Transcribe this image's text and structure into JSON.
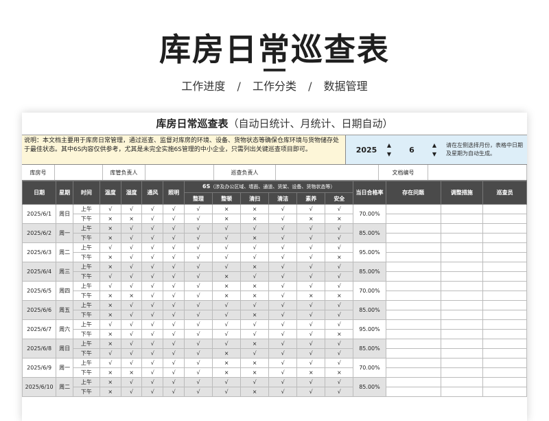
{
  "hero": {
    "title": "库房日常巡查表",
    "breadcrumb": [
      "工作进度",
      "工作分类",
      "数据管理"
    ],
    "sep": "/"
  },
  "sheet": {
    "title_main": "库房日常巡查表",
    "title_sub": "（自动日统计、月统计、日期自动）",
    "description": "说明：本文档主要用于库房日常管理，通过巡查、监督对库房的环境、设备、货物状态等确保仓库环境与货物储存处于最佳状态。其中6S内容仅供参考，尤其是未完全实施6S管理的中小企业，只需列出关键巡查项目即可。",
    "year": "2025",
    "month": "6",
    "spin_up": "▲",
    "spin_down": "▼",
    "hint": "请在左侧选择月份，表格中日期及星期为自动生成。",
    "meta": {
      "warehouse_no": "库房号",
      "warehouse_manager": "库管负责人",
      "inspector": "巡查负责人",
      "doc_no": "文档编号"
    },
    "headers": {
      "date": "日期",
      "weekday": "星期",
      "time": "时间",
      "temperature": "温度",
      "humidity": "湿度",
      "ventilation": "通风",
      "lighting": "照明",
      "six_s_title": "6S",
      "six_s_note": "（涉及办公区域、墙面、通道、货架、设备、货物状态等）",
      "six_s": [
        "整理",
        "整顿",
        "清扫",
        "清洁",
        "素养",
        "安全"
      ],
      "pass_rate": "当日合格率",
      "issues": "存在问题",
      "measures": "调整措施",
      "inspector_col": "巡查员"
    },
    "rows": [
      {
        "date": "2025/6/1",
        "weekday": "周日",
        "rate": "70.00%",
        "am": [
          "上午",
          "√",
          "√",
          "√",
          "√",
          "√",
          "×",
          "×",
          "√",
          "√",
          "√"
        ],
        "pm": [
          "下午",
          "×",
          "×",
          "√",
          "√",
          "√",
          "×",
          "×",
          "√",
          "×",
          "×"
        ]
      },
      {
        "date": "2025/6/2",
        "weekday": "周一",
        "rate": "85.00%",
        "am": [
          "上午",
          "×",
          "√",
          "√",
          "√",
          "√",
          "√",
          "√",
          "√",
          "√",
          "√"
        ],
        "pm": [
          "下午",
          "×",
          "√",
          "√",
          "√",
          "√",
          "√",
          "×",
          "√",
          "√",
          "√"
        ]
      },
      {
        "date": "2025/6/3",
        "weekday": "周二",
        "rate": "95.00%",
        "am": [
          "上午",
          "√",
          "√",
          "√",
          "√",
          "√",
          "√",
          "√",
          "√",
          "√",
          "√"
        ],
        "pm": [
          "下午",
          "×",
          "√",
          "√",
          "√",
          "√",
          "√",
          "√",
          "√",
          "√",
          "×"
        ]
      },
      {
        "date": "2025/6/4",
        "weekday": "周三",
        "rate": "85.00%",
        "am": [
          "上午",
          "×",
          "√",
          "√",
          "√",
          "√",
          "√",
          "×",
          "√",
          "√",
          "√"
        ],
        "pm": [
          "下午",
          "√",
          "√",
          "√",
          "√",
          "√",
          "×",
          "√",
          "√",
          "√",
          "√"
        ]
      },
      {
        "date": "2025/6/5",
        "weekday": "周四",
        "rate": "70.00%",
        "am": [
          "上午",
          "√",
          "√",
          "√",
          "√",
          "√",
          "×",
          "×",
          "√",
          "√",
          "√"
        ],
        "pm": [
          "下午",
          "×",
          "×",
          "√",
          "√",
          "√",
          "×",
          "×",
          "√",
          "×",
          "×"
        ]
      },
      {
        "date": "2025/6/6",
        "weekday": "周五",
        "rate": "85.00%",
        "am": [
          "上午",
          "×",
          "√",
          "√",
          "√",
          "√",
          "√",
          "√",
          "√",
          "√",
          "√"
        ],
        "pm": [
          "下午",
          "×",
          "√",
          "√",
          "√",
          "√",
          "√",
          "×",
          "√",
          "√",
          "√"
        ]
      },
      {
        "date": "2025/6/7",
        "weekday": "周六",
        "rate": "95.00%",
        "am": [
          "上午",
          "√",
          "√",
          "√",
          "√",
          "√",
          "√",
          "√",
          "√",
          "√",
          "√"
        ],
        "pm": [
          "下午",
          "×",
          "√",
          "√",
          "√",
          "√",
          "√",
          "√",
          "√",
          "√",
          "×"
        ]
      },
      {
        "date": "2025/6/8",
        "weekday": "周日",
        "rate": "85.00%",
        "am": [
          "上午",
          "×",
          "√",
          "√",
          "√",
          "√",
          "√",
          "×",
          "√",
          "√",
          "√"
        ],
        "pm": [
          "下午",
          "√",
          "√",
          "√",
          "√",
          "√",
          "×",
          "√",
          "√",
          "√",
          "√"
        ]
      },
      {
        "date": "2025/6/9",
        "weekday": "周一",
        "rate": "70.00%",
        "am": [
          "上午",
          "√",
          "√",
          "√",
          "√",
          "√",
          "×",
          "×",
          "√",
          "√",
          "√"
        ],
        "pm": [
          "下午",
          "×",
          "×",
          "√",
          "√",
          "√",
          "×",
          "×",
          "√",
          "×",
          "×"
        ]
      },
      {
        "date": "2025/6/10",
        "weekday": "周二",
        "rate": "85.00%",
        "am": [
          "上午",
          "×",
          "√",
          "√",
          "√",
          "√",
          "√",
          "√",
          "√",
          "√",
          "√"
        ],
        "pm": [
          "下午",
          "×",
          "√",
          "√",
          "√",
          "√",
          "√",
          "×",
          "√",
          "√",
          "√"
        ]
      }
    ]
  }
}
